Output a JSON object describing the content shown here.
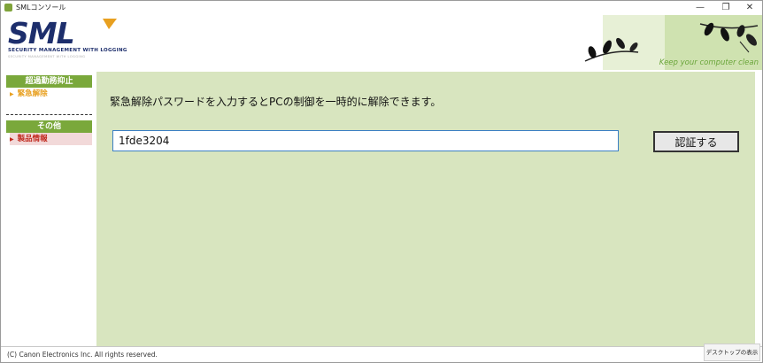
{
  "window": {
    "title": "SMLコンソール",
    "controls": {
      "minimize": "—",
      "restore": "❐",
      "close": "✕"
    }
  },
  "header": {
    "logo_text": "SML",
    "logo_subtitle": "SECURITY MANAGEMENT WITH LOGGING",
    "logo_subtitle2": "SECURITY MANAGEMENT WITH LOGGING",
    "tagline": "Keep your computer clean",
    "colors": {
      "logo": "#1d2e6c",
      "accent": "#7aa83b",
      "swoosh": "#e8a020"
    }
  },
  "sidebar": {
    "sections": [
      {
        "heading": "超過勤務抑止",
        "items": [
          {
            "label": "緊急解除",
            "color": "#e8a020",
            "selected": false
          }
        ]
      },
      {
        "heading": "その他",
        "items": [
          {
            "label": "製品情報",
            "color": "#c0281c",
            "selected": true
          }
        ]
      }
    ],
    "arrow_glyph": "▶"
  },
  "main": {
    "instruction": "緊急解除パスワードを入力するとPCの制御を一時的に解除できます。",
    "password_value": "1fde3204",
    "auth_button_label": "認証する",
    "background": "#d8e5bf"
  },
  "footer": {
    "copyright": "(C) Canon Electronics Inc.   All rights reserved.",
    "desktop_button": "デスクトップの表示"
  }
}
